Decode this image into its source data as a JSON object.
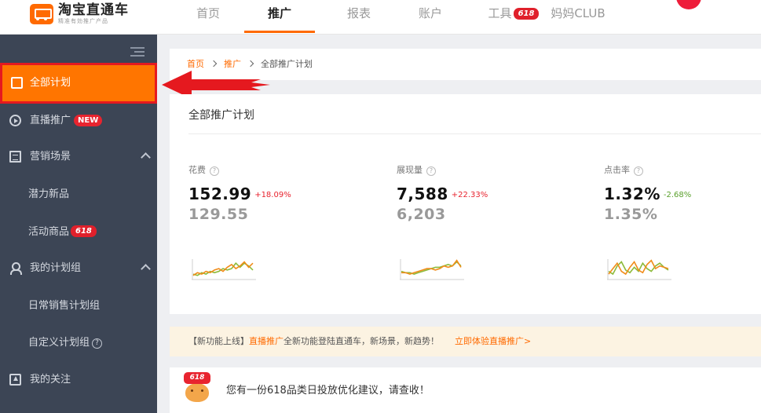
{
  "app": {
    "logo_title": "淘宝直通车",
    "logo_subtitle": "精准有効推广产品"
  },
  "nav": {
    "items": [
      {
        "label": "首页",
        "active": false
      },
      {
        "label": "推广",
        "active": true
      },
      {
        "label": "报表",
        "active": false
      },
      {
        "label": "账户",
        "active": false
      },
      {
        "label": "工具",
        "active": false,
        "badge": "618"
      },
      {
        "label": "妈妈CLUB",
        "active": false
      }
    ]
  },
  "sidebar": {
    "items": [
      {
        "label": "全部计划",
        "icon": "plan-icon",
        "active": true
      },
      {
        "label": "直播推广",
        "icon": "play-circle-icon",
        "badge": "NEW"
      },
      {
        "label": "营销场景",
        "icon": "document-icon",
        "expanded": true
      },
      {
        "label": "潜力新品",
        "sub": true
      },
      {
        "label": "活动商品",
        "sub": true,
        "badge": "618"
      },
      {
        "label": "我的计划组",
        "icon": "user-icon",
        "expanded": true
      },
      {
        "label": "日常销售计划组",
        "sub": true
      },
      {
        "label": "自定义计划组",
        "sub": true,
        "help": "?"
      },
      {
        "label": "我的关注",
        "icon": "favorite-icon"
      }
    ]
  },
  "breadcrumb": {
    "home": "首页",
    "promo": "推广",
    "current": "全部推广计划"
  },
  "overview": {
    "title": "全部推广计划",
    "help_glyph": "?",
    "metrics": [
      {
        "label": "花费",
        "value": "152.99",
        "delta": "+18.09%",
        "delta_color": "#e8242f",
        "previous": "129.55",
        "spark": {
          "orange": [
            3,
            5,
            4,
            6,
            5,
            7,
            8,
            6,
            9,
            11,
            8,
            10,
            13,
            9,
            12
          ],
          "green": [
            4,
            3,
            5,
            4,
            6,
            5,
            6,
            8,
            7,
            8,
            12,
            9,
            12,
            10,
            7
          ]
        }
      },
      {
        "label": "展现量",
        "value": "7,588",
        "delta": "+22.33%",
        "delta_color": "#e8242f",
        "previous": "6,203",
        "spark": {
          "orange": [
            5,
            5,
            4,
            5,
            6,
            7,
            8,
            8,
            7,
            8,
            10,
            9,
            10,
            14,
            9
          ],
          "green": [
            6,
            5,
            5,
            4,
            5,
            6,
            7,
            8,
            9,
            9,
            10,
            11,
            10,
            13,
            10
          ]
        }
      },
      {
        "label": "点击率",
        "value": "1.32%",
        "delta": "-2.68%",
        "delta_color": "#5aa02c",
        "previous": "1.35%",
        "spark": {
          "orange": [
            4,
            8,
            12,
            6,
            4,
            9,
            13,
            7,
            5,
            11,
            14,
            8,
            10,
            9,
            8
          ],
          "green": [
            6,
            4,
            10,
            13,
            7,
            5,
            9,
            6,
            12,
            8,
            6,
            10,
            12,
            9,
            7
          ]
        }
      }
    ]
  },
  "notice": {
    "prefix": "【新功能上线】",
    "highlight": "直播推广",
    "body": "全新功能登陆直通车，新场景，新趋势！",
    "cta": "立即体验直播推广>"
  },
  "advice": {
    "tag": "618",
    "text": "您有一份618品类日投放优化建议，请查收！"
  },
  "colors": {
    "accent": "#ff6a00",
    "sidebar_bg": "#3c4555",
    "highlight_border": "#e5191f",
    "spark_orange": "#f08c1a",
    "spark_green": "#8cba3a"
  }
}
